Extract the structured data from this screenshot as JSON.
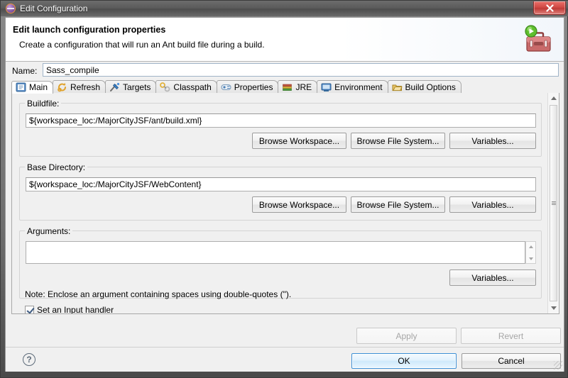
{
  "window": {
    "title": "Edit Configuration",
    "icon": "eclipse-icon",
    "close_label": "✕"
  },
  "banner": {
    "title": "Edit launch configuration properties",
    "subtitle": "Create a configuration that will run an Ant build file during a build.",
    "icon": "ant-toolbox-icon"
  },
  "name_field": {
    "label": "Name:",
    "value": "Sass_compile",
    "placeholder": ""
  },
  "tabs": [
    {
      "label": "Main",
      "icon": "main-tab-icon",
      "selected": true
    },
    {
      "label": "Refresh",
      "icon": "refresh-tab-icon",
      "selected": false
    },
    {
      "label": "Targets",
      "icon": "targets-tab-icon",
      "selected": false
    },
    {
      "label": "Classpath",
      "icon": "classpath-tab-icon",
      "selected": false
    },
    {
      "label": "Properties",
      "icon": "properties-tab-icon",
      "selected": false
    },
    {
      "label": "JRE",
      "icon": "jre-tab-icon",
      "selected": false
    },
    {
      "label": "Environment",
      "icon": "environment-tab-icon",
      "selected": false
    },
    {
      "label": "Build Options",
      "icon": "build-options-tab-icon",
      "selected": false
    }
  ],
  "main_tab": {
    "buildfile": {
      "group_label": "Buildfile:",
      "value": "${workspace_loc:/MajorCityJSF/ant/build.xml}",
      "browse_workspace": "Browse Workspace...",
      "browse_file_system": "Browse File System...",
      "variables": "Variables..."
    },
    "base_directory": {
      "group_label": "Base Directory:",
      "value": "${workspace_loc:/MajorCityJSF/WebContent}",
      "browse_workspace": "Browse Workspace...",
      "browse_file_system": "Browse File System...",
      "variables": "Variables..."
    },
    "arguments": {
      "group_label": "Arguments:",
      "value": "",
      "variables": "Variables...",
      "note": "Note: Enclose an argument containing spaces using double-quotes (\")."
    },
    "input_handler": {
      "label": "Set an Input handler",
      "checked": true
    }
  },
  "action_buttons": {
    "apply": "Apply",
    "apply_enabled": false,
    "revert": "Revert",
    "revert_enabled": false
  },
  "dialog_buttons": {
    "help": "?",
    "ok": "OK",
    "cancel": "Cancel"
  },
  "colors": {
    "accent_blue": "#3c8fd6",
    "dialog_bg": "#f0f0f0",
    "banner_bg": "#ffffff",
    "close_red": "#d14a45"
  }
}
